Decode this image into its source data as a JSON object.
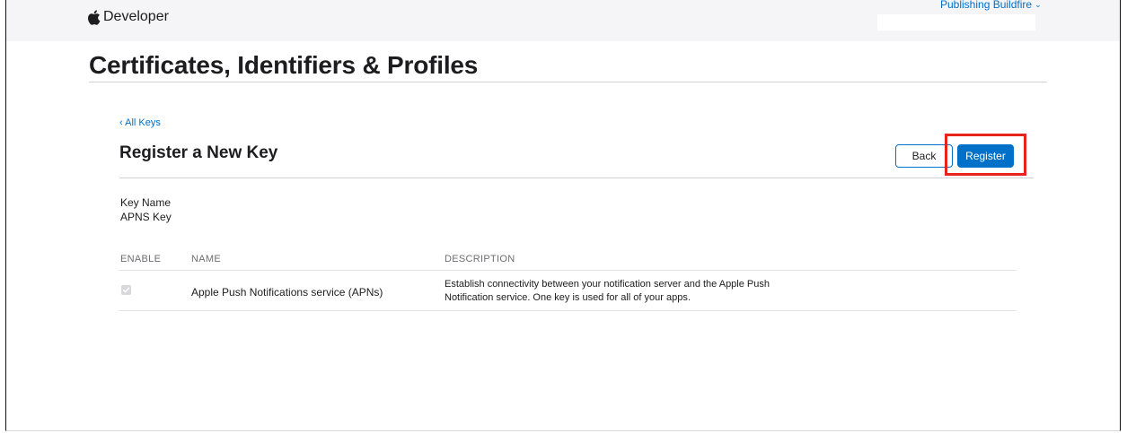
{
  "header": {
    "brand": "Developer",
    "account": "Publishing Buildfire"
  },
  "page_title": "Certificates, Identifiers & Profiles",
  "breadcrumb": {
    "back_label": "‹ All Keys"
  },
  "section": {
    "title": "Register a New Key",
    "back_button": "Back",
    "register_button": "Register"
  },
  "key": {
    "name_label": "Key Name",
    "name_value": "APNS Key"
  },
  "table": {
    "headers": [
      "ENABLE",
      "NAME",
      "DESCRIPTION"
    ],
    "rows": [
      {
        "enabled": true,
        "name": "Apple Push Notifications service (APNs)",
        "description_line1": "Establish connectivity between your notification server and the Apple Push",
        "description_line2": "Notification service. One key is used for all of your apps."
      }
    ]
  },
  "colors": {
    "accent": "#0070c9",
    "highlight": "#e8231b"
  }
}
